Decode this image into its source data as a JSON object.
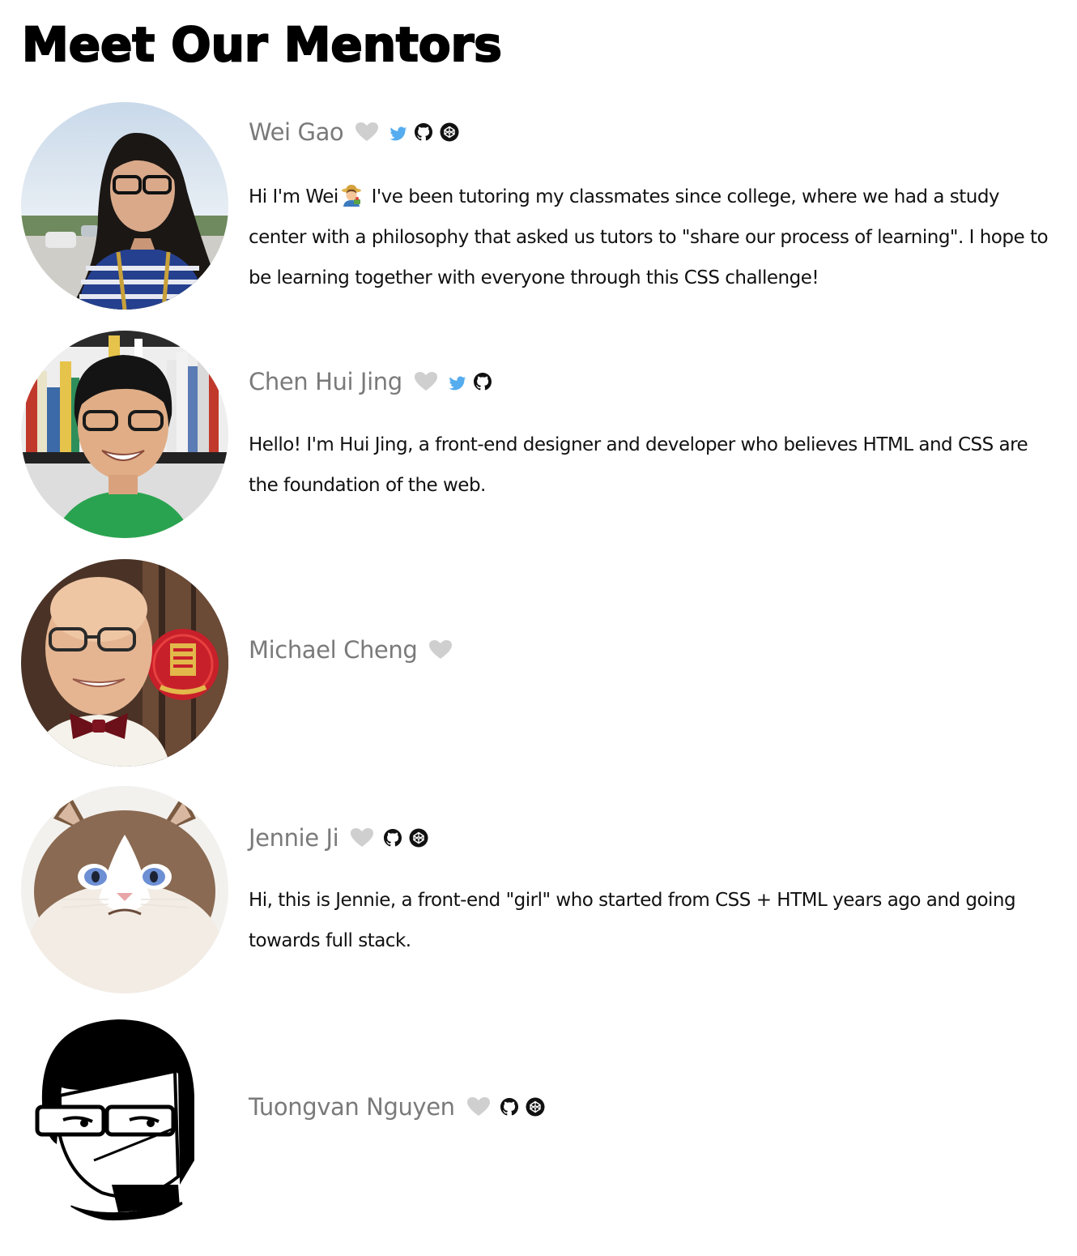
{
  "page": {
    "title": "Meet Our Mentors"
  },
  "mentors": [
    {
      "name": "Wei Gao",
      "bio_before": "Hi I'm Wei",
      "bio_emoji": "woman-farmer-emoji",
      "bio_after": " I've been tutoring my classmates since college, where we had a study center with a philosophy that asked us tutors to \"share our process of learning\". I hope to be learning together with everyone through this CSS challenge!",
      "icons": [
        "twitter-icon",
        "github-icon",
        "codepen-icon"
      ]
    },
    {
      "name": "Chen Hui Jing",
      "bio": "Hello! I'm Hui Jing, a front-end designer and developer who believes HTML and CSS are the foundation of the web.",
      "icons": [
        "twitter-icon",
        "github-icon"
      ]
    },
    {
      "name": "Michael Cheng",
      "bio": "",
      "icons": []
    },
    {
      "name": "Jennie Ji",
      "bio": "Hi, this is Jennie, a front-end \"girl\" who started from CSS + HTML years ago and going towards full stack.",
      "icons": [
        "github-icon",
        "codepen-icon"
      ]
    },
    {
      "name": "Tuongvan Nguyen",
      "bio": "",
      "icons": [
        "github-icon",
        "codepen-icon"
      ]
    }
  ],
  "colors": {
    "name_gray": "#7a7a7a",
    "heart_gray": "#cfcfcf",
    "twitter_blue": "#55acee",
    "text": "#111111"
  }
}
